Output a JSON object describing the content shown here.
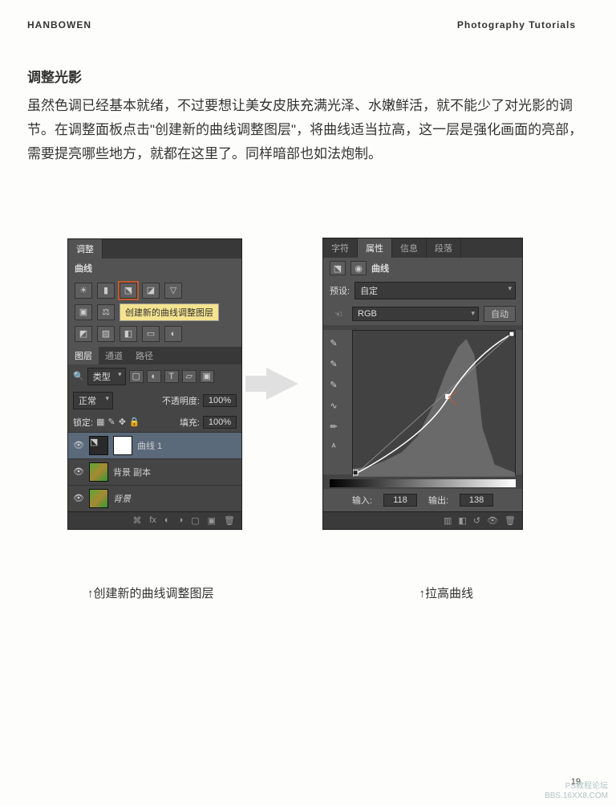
{
  "header": {
    "left": "HANBOWEN",
    "right": "Photography Tutorials"
  },
  "section": {
    "title": "调整光影",
    "body": "虽然色调已经基本就绪，不过要想让美女皮肤充满光泽、水嫩鲜活，就不能少了对光影的调节。在调整面板点击\"创建新的曲线调整图层\"，将曲线适当拉高，这一层是强化画面的亮部，需要提亮哪些地方，就都在这里了。同样暗部也如法炮制。"
  },
  "left_panel": {
    "tab_adjust": "调整",
    "curves_label": "曲线",
    "tooltip": "创建新的曲线调整图层",
    "layers_tabs": {
      "layers": "图层",
      "channels": "通道",
      "paths": "路径"
    },
    "kind_filter": "类型",
    "blend_mode": "正常",
    "opacity_label": "不透明度:",
    "opacity_value": "100%",
    "lock_label": "锁定:",
    "fill_label": "填充:",
    "fill_value": "100%",
    "layer_curves": "曲线 1",
    "layer_bgcopy": "背景 副本",
    "layer_bg": "背景"
  },
  "right_panel": {
    "tabs": {
      "char": "字符",
      "prop": "属性",
      "info": "信息",
      "para": "段落"
    },
    "curves_label": "曲线",
    "preset_label": "预设:",
    "preset_value": "自定",
    "channel_value": "RGB",
    "auto_btn": "自动",
    "input_label": "输入:",
    "input_value": "118",
    "output_label": "输出:",
    "output_value": "138"
  },
  "captions": {
    "left": "↑创建新的曲线调整图层",
    "right": "↑拉高曲线"
  },
  "watermark": {
    "line1": "PS教程论坛",
    "line2": "BBS.16XX8.COM"
  },
  "pagenum": "19"
}
